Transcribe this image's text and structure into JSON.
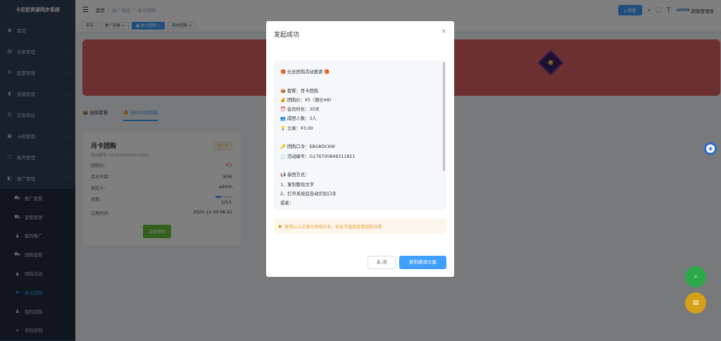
{
  "app": {
    "title": "卡尼奶资源同步系统"
  },
  "sidebar": {
    "items": [
      {
        "label": "首页",
        "icon": "dashboard-icon",
        "glyph": "◉"
      },
      {
        "label": "文章管理",
        "icon": "document-icon",
        "glyph": "▤"
      },
      {
        "label": "配置管理",
        "icon": "settings-icon",
        "glyph": "⚙"
      },
      {
        "label": "投稿管理",
        "icon": "chart-icon",
        "glyph": "▮"
      },
      {
        "label": "应用商店",
        "icon": "list-icon",
        "glyph": "☰"
      },
      {
        "label": "卡密管理",
        "icon": "card-icon",
        "glyph": "▣"
      },
      {
        "label": "账号管理",
        "icon": "account-icon",
        "glyph": "▢"
      },
      {
        "label": "推广管理",
        "icon": "promo-icon",
        "glyph": "◧"
      }
    ],
    "subitems": [
      {
        "label": "推广套餐",
        "icon": "cart-icon",
        "glyph": "⛟"
      },
      {
        "label": "套餐管理",
        "icon": "cart-icon",
        "glyph": "⛟"
      },
      {
        "label": "我的推广",
        "icon": "user-icon",
        "glyph": "♟"
      },
      {
        "label": "团购套餐",
        "icon": "cart-icon",
        "glyph": "⛟"
      },
      {
        "label": "团购活动",
        "icon": "user-icon",
        "glyph": "♟"
      },
      {
        "label": "参与团购",
        "icon": "star-icon",
        "glyph": "★"
      },
      {
        "label": "我的团购",
        "icon": "person-icon",
        "glyph": "♟"
      },
      {
        "label": "风险控制",
        "icon": "plus-icon",
        "glyph": "+"
      }
    ]
  },
  "header": {
    "breadcrumb": [
      "首页",
      "推广管理",
      "参与团购"
    ],
    "home_button": "⌂ 概要",
    "admin_label": "超级管理员",
    "admin_logo": "ADMIN"
  },
  "tagsview": [
    "首页",
    "推广套餐 ×",
    "● 参与团购 ×",
    "我的团购 ×"
  ],
  "page": {
    "tabs": [
      "选择套餐",
      "进行中的团购"
    ],
    "card": {
      "title": "月卡团购",
      "code": "活动编号: G176700848311821",
      "status": "进行中",
      "rows": [
        {
          "k": "团购价:",
          "v": "¥5"
        },
        {
          "k": "会员天数:",
          "v": "30天"
        },
        {
          "k": "发起人:",
          "v": "admin"
        },
        {
          "k": "进度:",
          "v": "1/3人"
        },
        {
          "k": "过期时间:",
          "v": "2025-12-30 06:41"
        }
      ],
      "progress": 0.33,
      "join_button": "立即参团"
    }
  },
  "dialog": {
    "title": "发起成功",
    "close_glyph": "×",
    "lines": [
      "🎁 元旦团购活动邀请 🎁",
      "",
      "📦 套餐：月卡团购",
      "💰 团购价：¥5（原价¥8）",
      "⏰ 会员时长：30天",
      "👥 成团人数：3人",
      "💡 立省：¥3.00",
      "",
      "🔑 团购口令：EBG8DC6W",
      "🧾 活动编号：G176700848311821",
      "",
      "📢 参团方式：",
      "1、复制整段文字",
      "2、打开系统后自动识别口令",
      "或者："
    ],
    "notice": "复制以上文案分享给好友，好友可直接查看团购详情",
    "close_button": "关 闭",
    "copy_button": "复制邀请文案"
  },
  "colors": {
    "primary": "#409eff",
    "sidebar": "#304156",
    "banner": "#d86060",
    "success": "#67c23a",
    "warning": "#e6a23c"
  }
}
